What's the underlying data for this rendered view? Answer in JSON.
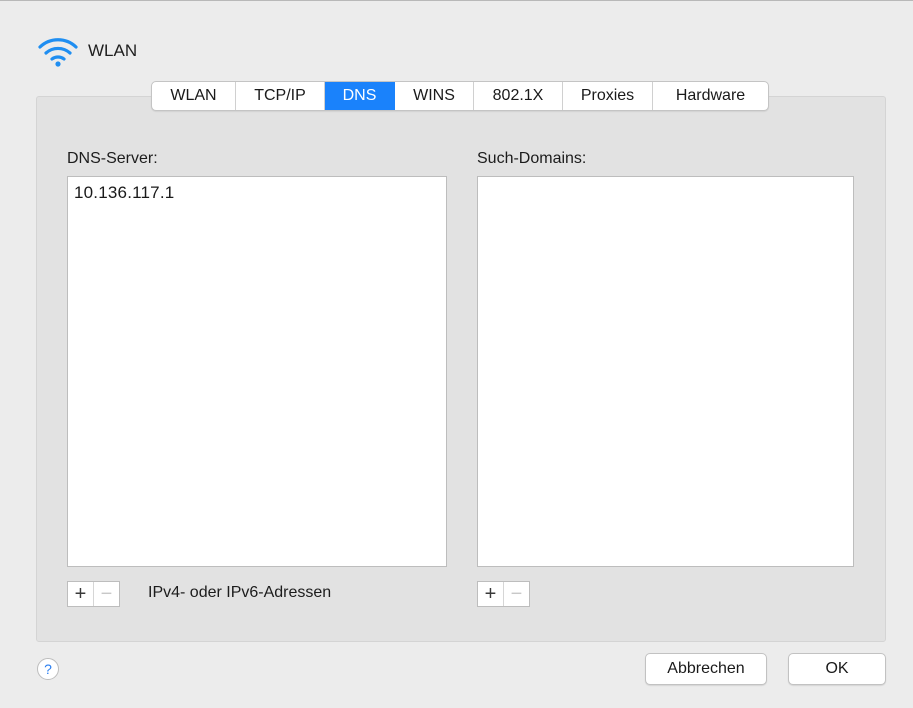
{
  "window": {
    "title": "WLAN",
    "icon": "wifi-icon"
  },
  "tabs": [
    {
      "label": "WLAN",
      "active": false
    },
    {
      "label": "TCP/IP",
      "active": false
    },
    {
      "label": "DNS",
      "active": true
    },
    {
      "label": "WINS",
      "active": false
    },
    {
      "label": "802.1X",
      "active": false
    },
    {
      "label": "Proxies",
      "active": false
    },
    {
      "label": "Hardware",
      "active": false
    }
  ],
  "dns": {
    "servers_label": "DNS-Server:",
    "servers": [
      "10.136.117.1"
    ],
    "servers_hint": "IPv4- oder IPv6-Adressen",
    "domains_label": "Such-Domains:",
    "domains": []
  },
  "controls": {
    "add_symbol": "+",
    "remove_symbol": "−"
  },
  "footer": {
    "help": "?",
    "cancel": "Abbrechen",
    "ok": "OK"
  },
  "colors": {
    "accent": "#1a82fb",
    "help_glyph": "#2a7ef0"
  }
}
